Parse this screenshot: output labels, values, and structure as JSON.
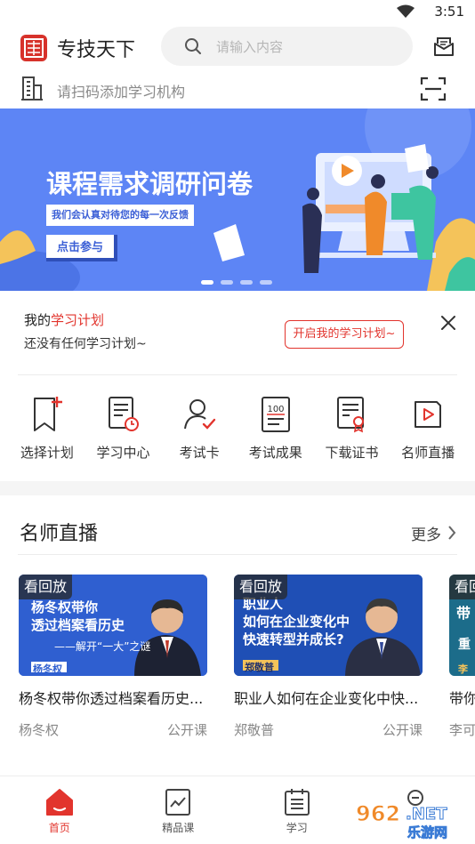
{
  "status": {
    "time": "3:51"
  },
  "header": {
    "app_title": "专技天下",
    "search_placeholder": "请输入内容"
  },
  "org": {
    "hint": "请扫码添加学习机构"
  },
  "banner": {
    "title": "课程需求调研问卷",
    "subtitle": "我们会认真对待您的每一次反馈",
    "button": "点击参与",
    "dots_count": 4,
    "active_dot": 0
  },
  "plan": {
    "title_prefix": "我的",
    "title_highlight": "学习计划",
    "empty_text": "还没有任何学习计划~",
    "start_button": "开启我的学习计划~"
  },
  "quick_menu": [
    {
      "label": "选择计划",
      "icon": "bookmark-plus-icon"
    },
    {
      "label": "学习中心",
      "icon": "study-list-clock-icon"
    },
    {
      "label": "考试卡",
      "icon": "user-check-icon"
    },
    {
      "label": "考试成果",
      "icon": "score-100-icon"
    },
    {
      "label": "下载证书",
      "icon": "certificate-icon"
    },
    {
      "label": "名师直播",
      "icon": "live-play-icon"
    }
  ],
  "live_section": {
    "title": "名师直播",
    "more": "更多",
    "cards": [
      {
        "badge": "看回放",
        "thumb_lines": [
          "杨冬权带你",
          "透过档案看历史",
          "——解开“一大”之谜"
        ],
        "thumb_name": "杨冬权",
        "title": "杨冬权带你透过档案看历史...",
        "author": "杨冬权",
        "type": "公开课",
        "bg": "#2f5fd0"
      },
      {
        "badge": "看回放",
        "thumb_lines": [
          "职业人",
          "如何在企业变化中",
          "快速转型并成长?"
        ],
        "thumb_name": "郑敬普",
        "title": "职业人如何在企业变化中快...",
        "author": "郑敬普",
        "type": "公开课",
        "bg": "#1f4fb5"
      },
      {
        "badge": "看回放",
        "thumb_lines": [
          "带",
          "重"
        ],
        "thumb_name": "李",
        "title": "带你",
        "author": "李可",
        "type": "",
        "bg": "#1c6c8a"
      }
    ]
  },
  "tabbar": [
    {
      "label": "首页",
      "icon": "home-icon",
      "active": true
    },
    {
      "label": "精品课",
      "icon": "course-chart-icon",
      "active": false
    },
    {
      "label": "学习",
      "icon": "calendar-list-icon",
      "active": false
    },
    {
      "label": "",
      "icon": "profile-icon",
      "active": false
    }
  ],
  "watermark": {
    "text": "962.NET 乐游网"
  },
  "colors": {
    "accent": "#e2342d",
    "banner_bg": "#5d85f5"
  }
}
